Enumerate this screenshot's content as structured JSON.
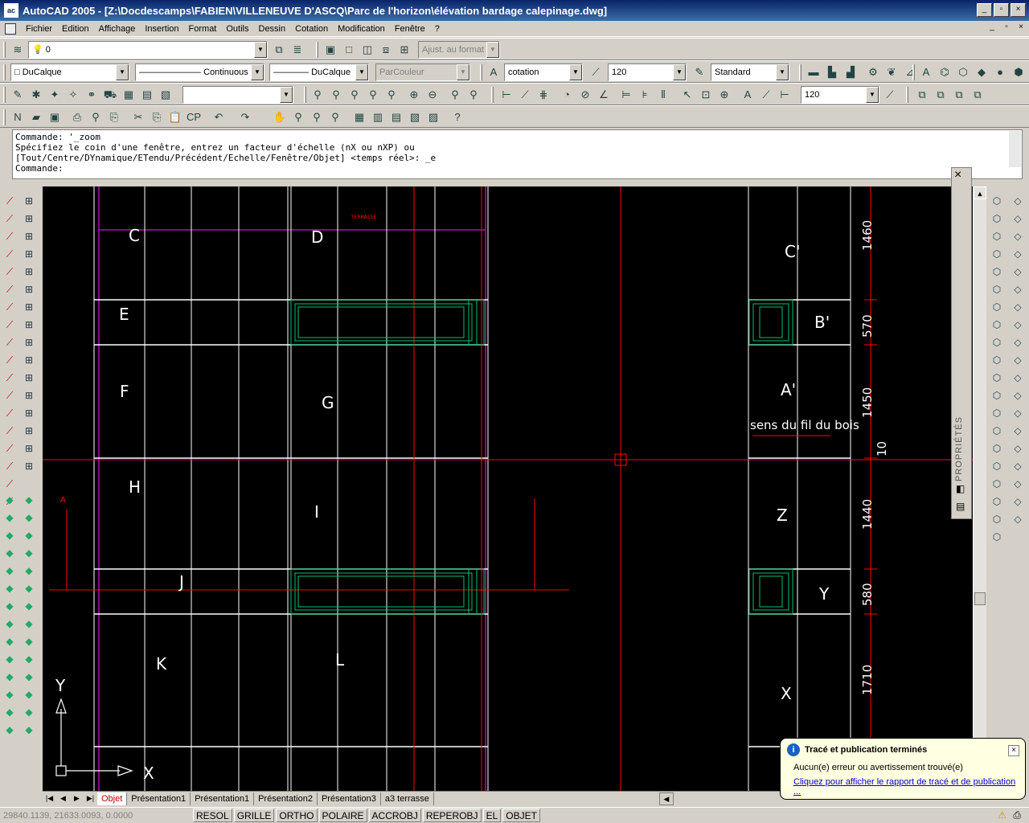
{
  "window": {
    "title": "AutoCAD 2005 - [Z:\\Docdescamps\\FABIEN\\VILLENEUVE D'ASCQ\\Parc de l'horizon\\élévation bardage calepinage.dwg]",
    "app_icon": "acad-icon",
    "minimize": "_",
    "maximize": "▫",
    "close": "×"
  },
  "menu": {
    "items": [
      "Fichier",
      "Edition",
      "Affichage",
      "Insertion",
      "Format",
      "Outils",
      "Dessin",
      "Cotation",
      "Modification",
      "Fenêtre",
      "?"
    ]
  },
  "toolbars": {
    "layer_value": "0",
    "layer_dropdown_disabled": "Ajust. au format",
    "color": "DuCalque",
    "linetype": "Continuous",
    "lineweight": "DuCalque",
    "plotstyle": "ParCouleur",
    "dimstyle": "cotation",
    "dimscale": "120",
    "textstyle": "Standard",
    "empty_combo": "",
    "scale2": "120"
  },
  "command": {
    "line1": "Commande: '_zoom",
    "line2": "Spécifiez le coin d'une fenêtre, entrez un facteur d'échelle (nX ou nXP) ou",
    "line3": "[Tout/Centre/DYnamique/ETendu/Précédent/Echelle/Fenêtre/Objet] <temps réel>: _e",
    "prompt": "Commande:"
  },
  "drawing": {
    "panel_letters_left": [
      "C",
      "D",
      "E",
      "F",
      "G",
      "H",
      "I",
      "J",
      "K",
      "L"
    ],
    "panel_letters_right": [
      "C'",
      "B'",
      "A'",
      "Z",
      "Y",
      "X"
    ],
    "dimensions": [
      "1460",
      "570",
      "1450",
      "10",
      "1440",
      "580",
      "1710"
    ],
    "annotation": "sens du fil du bois",
    "small_label": "TERRASSE",
    "section_mark": "A",
    "ucs_x": "X",
    "ucs_y": "Y"
  },
  "properties_panel": {
    "label": "PROPRIÉTÉS"
  },
  "tabs": [
    "Objet",
    "Présentation1",
    "Présentation1",
    "Présentation2",
    "Présentation3",
    "a3 terrasse"
  ],
  "status": {
    "coords": "29840.1139, 21633.0093, 0.0000",
    "buttons": [
      "RESOL",
      "GRILLE",
      "ORTHO",
      "POLAIRE",
      "ACCROBJ",
      "REPEROBJ",
      "EL",
      "OBJET"
    ]
  },
  "balloon": {
    "title": "Tracé et publication terminés",
    "message": "Aucun(e) erreur ou avertissement trouvé(e)",
    "link": "Cliquez pour afficher le rapport de tracé et de publication ..."
  },
  "colors": {
    "title_bar": "#0a246a",
    "canvas": "#000000",
    "drawing_lines": "#ffffff",
    "red_lines": "#ff0000",
    "green_lines": "#00c070",
    "magenta_lines": "#c000c0",
    "balloon": "#ffffe1"
  }
}
